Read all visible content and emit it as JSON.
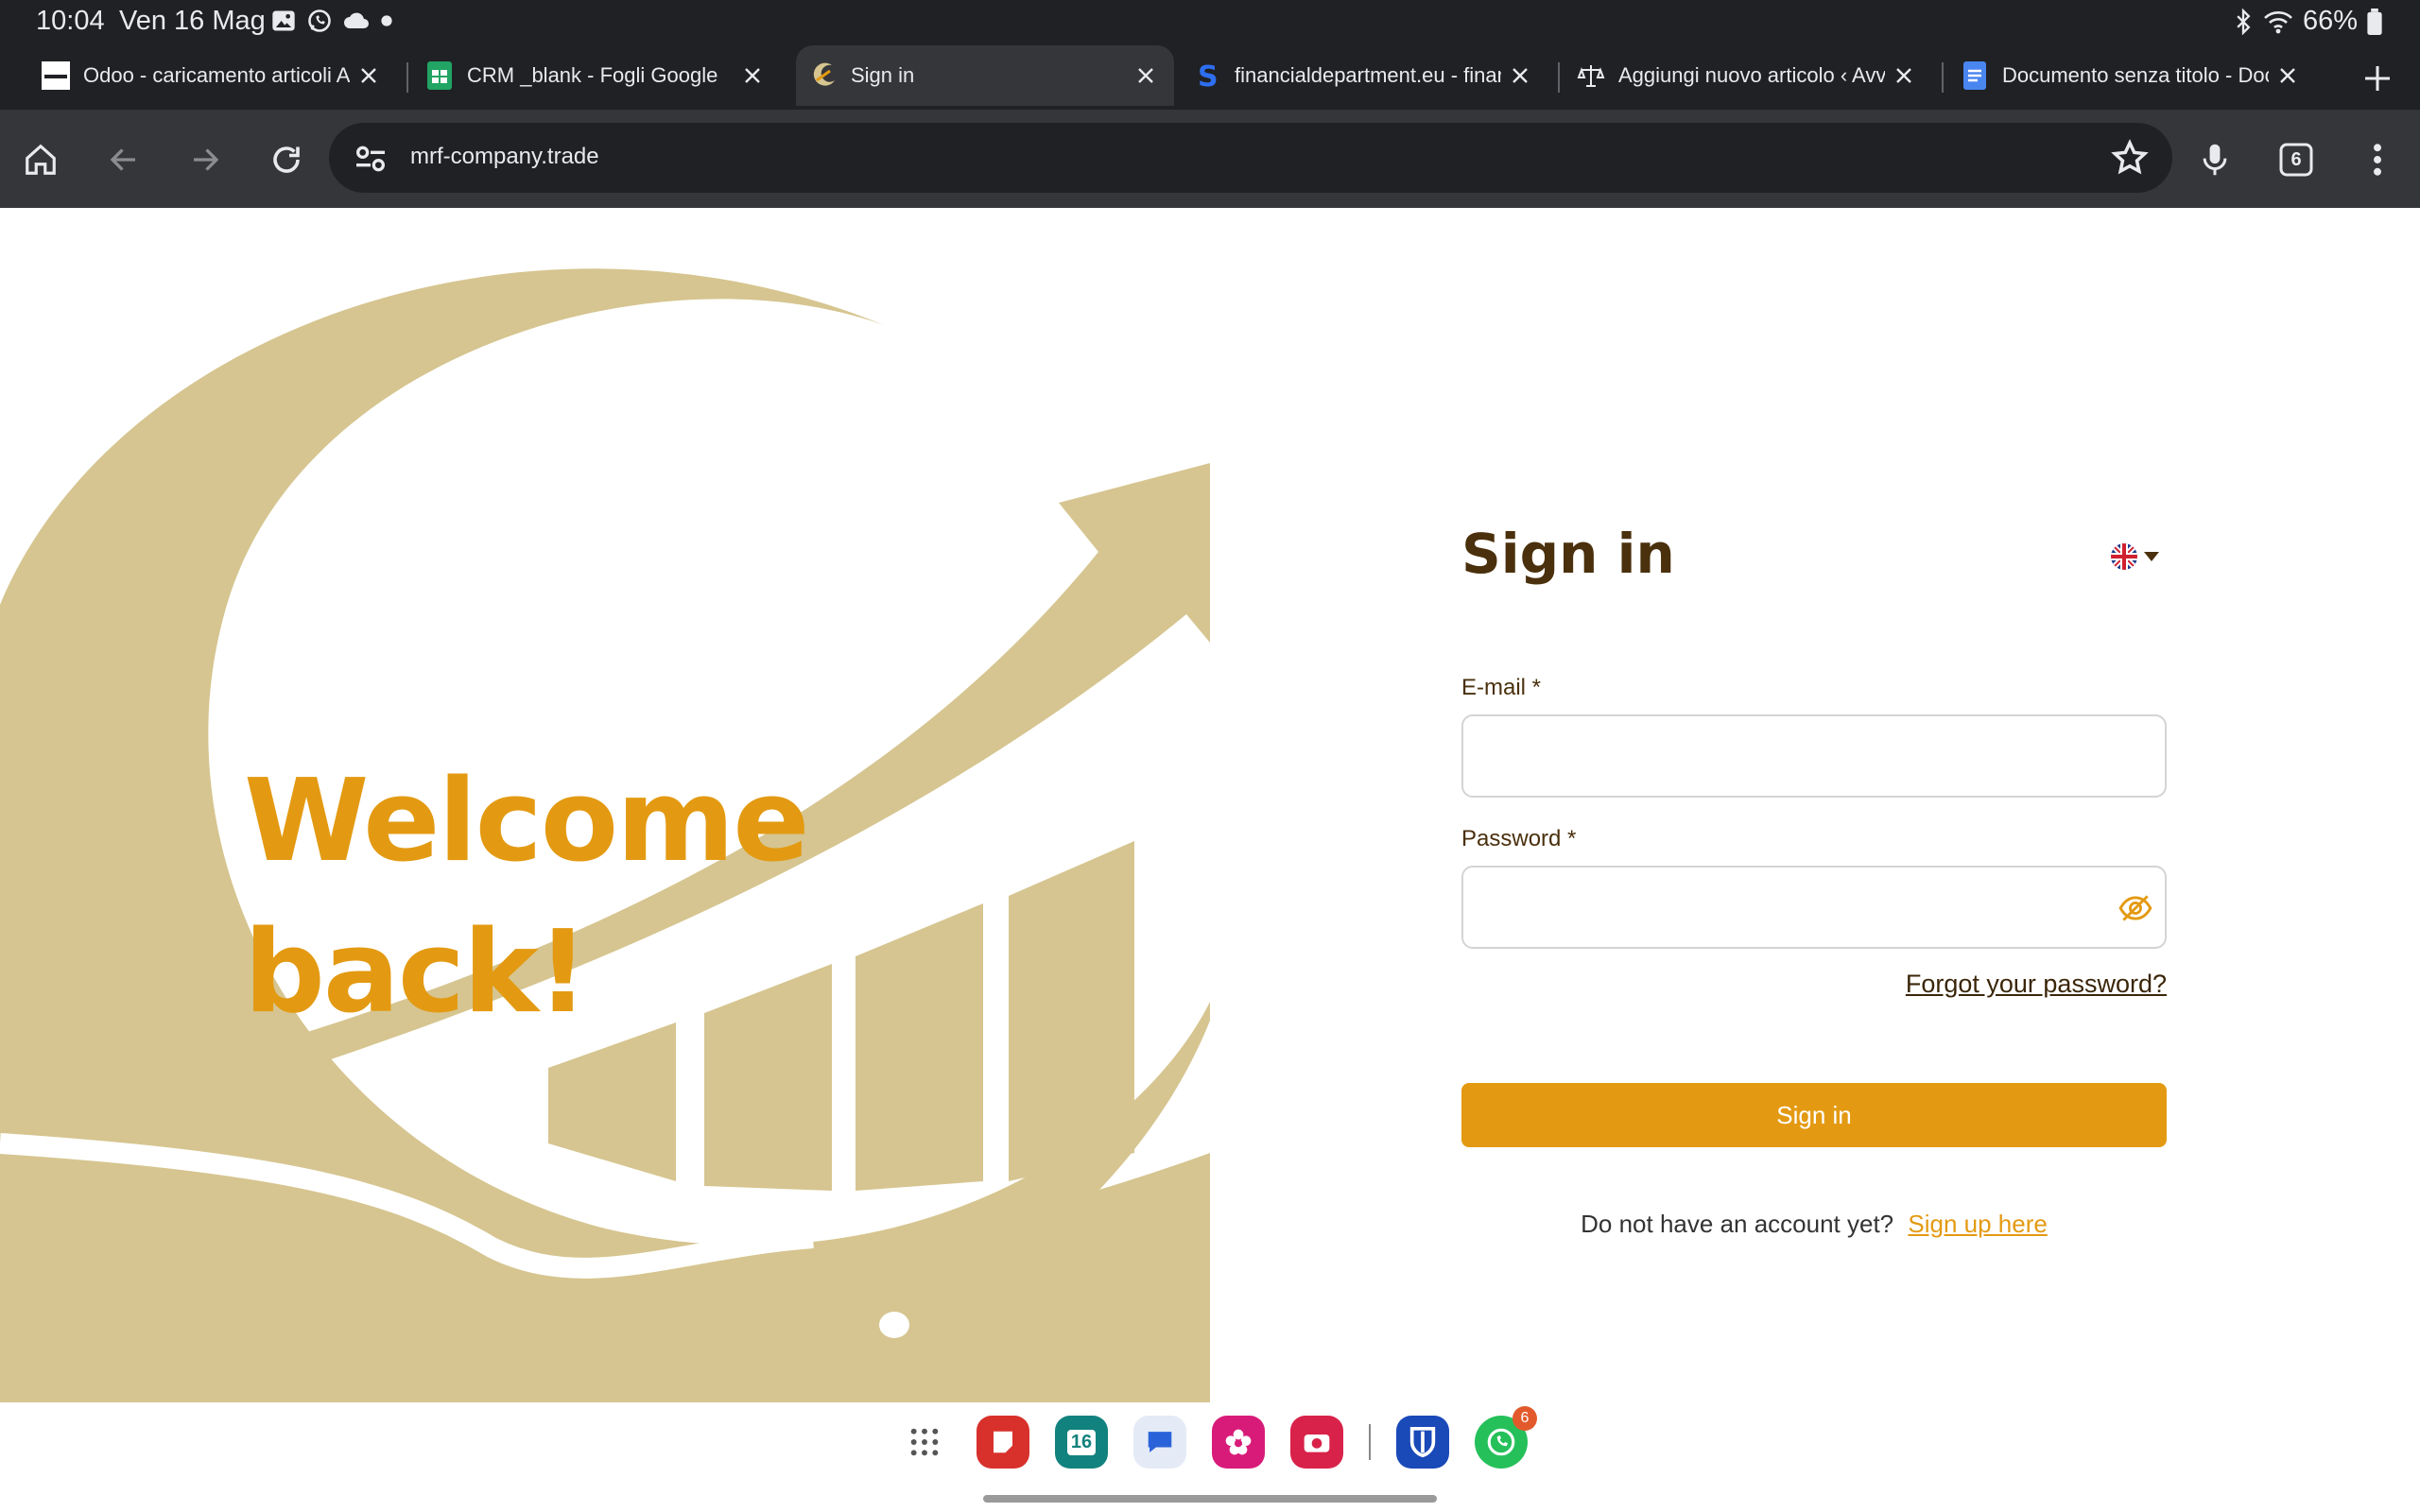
{
  "status_bar": {
    "time": "10:04",
    "date": "Ven 16 Mag",
    "battery": "66%"
  },
  "tabs": [
    {
      "title": "Odoo - caricamento articoli Avv",
      "favicon": "odoo-icon",
      "active": false
    },
    {
      "title": "CRM _blank - Fogli Google",
      "favicon": "sheets-icon",
      "active": false
    },
    {
      "title": "Sign in",
      "favicon": "mrf-logo-icon",
      "active": true
    },
    {
      "title": "financialdepartment.eu - financi",
      "favicon": "s-icon",
      "active": false
    },
    {
      "title": "Aggiungi nuovo articolo ‹ Avvoc",
      "favicon": "scales-icon",
      "active": false
    },
    {
      "title": "Documento senza titolo - Docum",
      "favicon": "docs-icon",
      "active": false
    }
  ],
  "toolbar": {
    "url": "mrf-company.trade",
    "tab_count": "6"
  },
  "hero": {
    "welcome_line1": "Welcome",
    "welcome_line2": "back!"
  },
  "form": {
    "title": "Sign in",
    "language": "en-GB",
    "email_label": "E-mail *",
    "email_value": "",
    "password_label": "Password *",
    "password_value": "",
    "forgot_link": "Forgot your password?",
    "submit_label": "Sign in",
    "signup_prompt": "Do not have an account yet?",
    "signup_link": "Sign up here"
  },
  "taskbar": {
    "calendar_day": "16",
    "whatsapp_badge": "6"
  },
  "colors": {
    "accent": "#e39a12",
    "heading": "#4a300d",
    "art": "#d6c590",
    "chrome_dark": "#202124",
    "chrome_toolbar": "#35363a"
  }
}
